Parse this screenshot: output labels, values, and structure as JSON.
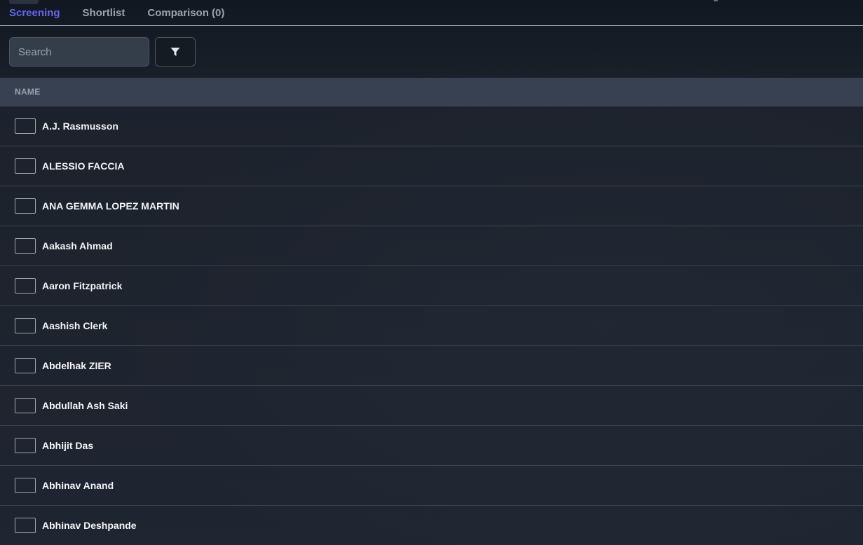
{
  "tabs": [
    {
      "label": "Screening",
      "active": true
    },
    {
      "label": "Shortlist",
      "active": false
    },
    {
      "label": "Comparison (0)",
      "active": false
    }
  ],
  "search": {
    "placeholder": "Search",
    "value": ""
  },
  "filter": {
    "icon": "filter-icon"
  },
  "table": {
    "header": "NAME",
    "rows": [
      {
        "name": "A.J. Rasmusson"
      },
      {
        "name": "ALESSIO FACCIA"
      },
      {
        "name": "ANA GEMMA LOPEZ MARTIN"
      },
      {
        "name": "Aakash Ahmad"
      },
      {
        "name": "Aaron Fitzpatrick"
      },
      {
        "name": "Aashish Clerk"
      },
      {
        "name": "Abdelhak ZIER"
      },
      {
        "name": "Abdullah Ash Saki"
      },
      {
        "name": "Abhijit Das"
      },
      {
        "name": "Abhinav Anand"
      },
      {
        "name": "Abhinav Deshpande"
      }
    ]
  },
  "colors": {
    "accent": "#6366f1",
    "background": "#1b2028",
    "header_bg": "#374151"
  }
}
